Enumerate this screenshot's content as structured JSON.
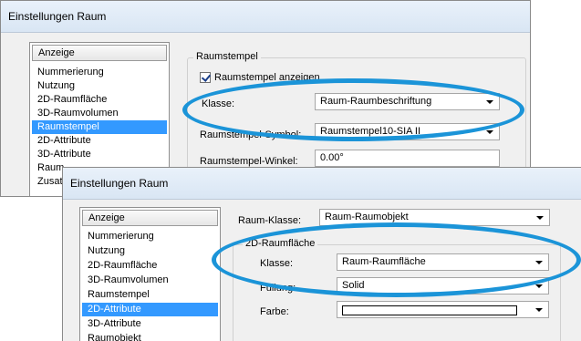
{
  "window1": {
    "title": "Einstellungen Raum",
    "list_header": "Anzeige",
    "list_items": [
      "Nummerierung",
      "Nutzung",
      "2D-Raumfläche",
      "3D-Raumvolumen",
      "Raumstempel",
      "2D-Attribute",
      "3D-Attribute",
      "Raum",
      "Zusat"
    ],
    "selected_item": "Raumstempel",
    "group_title": "Raumstempel",
    "checkbox_label": "Raumstempel anzeigen",
    "checkbox_checked": true,
    "klasse_label": "Klasse:",
    "klasse_value": "Raum-Raumbeschriftung",
    "symbol_label": "Raumstempel-Symbol:",
    "symbol_value": "Raumstempel10-SIA II",
    "winkel_label": "Raumstempel-Winkel:",
    "winkel_value": "0.00°"
  },
  "window2": {
    "title": "Einstellungen Raum",
    "list_header": "Anzeige",
    "list_items": [
      "Nummerierung",
      "Nutzung",
      "2D-Raumfläche",
      "3D-Raumvolumen",
      "Raumstempel",
      "2D-Attribute",
      "3D-Attribute",
      "Raumobjekt"
    ],
    "selected_item": "2D-Attribute",
    "raumklasse_label": "Raum-Klasse:",
    "raumklasse_value": "Raum-Raumobjekt",
    "group_title": "2D-Raumfläche",
    "klasse_label": "Klasse:",
    "klasse_value": "Raum-Raumfläche",
    "fuellung_label": "Füllung:",
    "fuellung_value": "Solid",
    "farbe_label": "Farbe:",
    "farbe_value": "#ffffff"
  },
  "highlight_color": "#1b94d8"
}
